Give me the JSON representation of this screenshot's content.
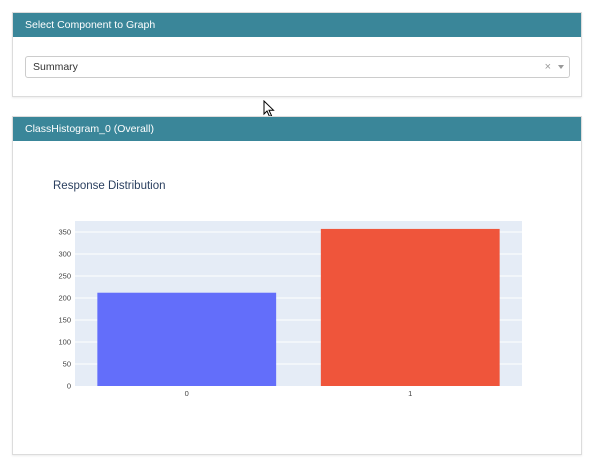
{
  "select_panel": {
    "header": "Select Component to Graph",
    "selected_value": "Summary",
    "clear_glyph": "×"
  },
  "histogram_panel": {
    "header": "ClassHistogram_0 (Overall)"
  },
  "chart_data": {
    "type": "bar",
    "title": "Response Distribution",
    "categories": [
      "0",
      "1"
    ],
    "values": [
      212,
      357
    ],
    "bar_colors": [
      "#636efa",
      "#ef553b"
    ],
    "ylim": [
      0,
      375
    ],
    "yticks": [
      0,
      50,
      100,
      150,
      200,
      250,
      300,
      350
    ],
    "grid": true,
    "plot_background": "#e5ecf6"
  },
  "colors": {
    "header_bg": "#3a8699",
    "header_text": "#ffffff"
  }
}
